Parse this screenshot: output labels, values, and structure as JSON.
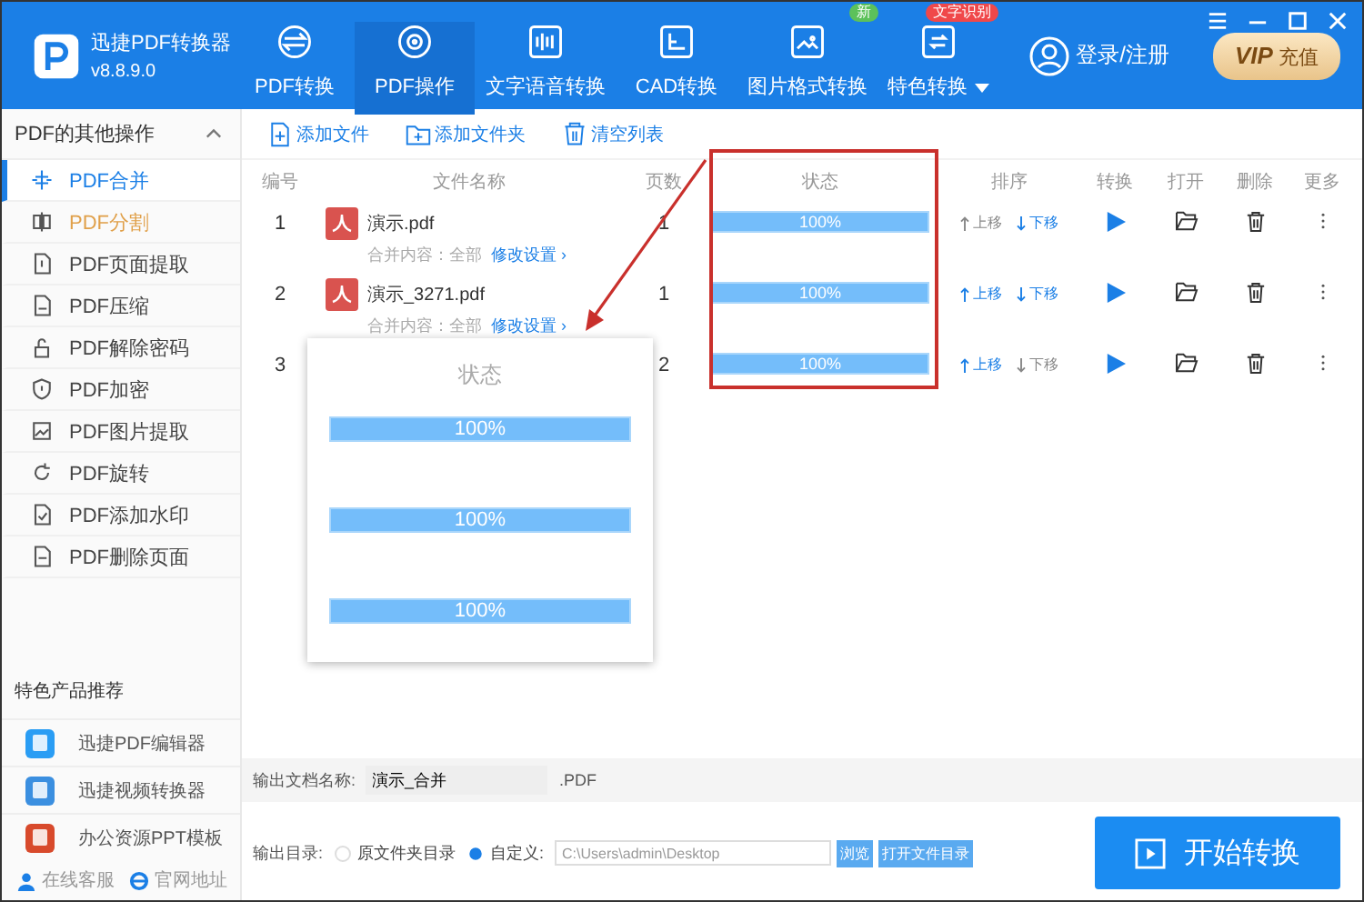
{
  "app": {
    "name": "迅捷PDF转换器",
    "version": "v8.8.9.0"
  },
  "nav": [
    {
      "label": "PDF转换",
      "selected": false
    },
    {
      "label": "PDF操作",
      "selected": true
    },
    {
      "label": "文字语音转换",
      "selected": false
    },
    {
      "label": "CAD转换",
      "selected": false
    },
    {
      "label": "图片格式转换",
      "selected": false,
      "badge": {
        "text": "新",
        "color": "#5cc15a"
      }
    },
    {
      "label": "特色转换",
      "selected": false,
      "badge": {
        "text": "文字识别",
        "color": "#f0484a"
      },
      "dropdown": true
    }
  ],
  "account": {
    "login": "登录/注册",
    "vip": "VIP",
    "vip_label": "充值"
  },
  "sidebar": {
    "title": "PDF的其他操作",
    "expanded": true,
    "items": [
      {
        "label": "PDF合并",
        "selected": true,
        "hovered": false
      },
      {
        "label": "PDF分割",
        "selected": false,
        "hovered": true
      },
      {
        "label": "PDF页面提取",
        "selected": false,
        "hovered": false
      },
      {
        "label": "PDF压缩",
        "selected": false,
        "hovered": false
      },
      {
        "label": "PDF解除密码",
        "selected": false,
        "hovered": false
      },
      {
        "label": "PDF加密",
        "selected": false,
        "hovered": false
      },
      {
        "label": "PDF图片提取",
        "selected": false,
        "hovered": false
      },
      {
        "label": "PDF旋转",
        "selected": false,
        "hovered": false
      },
      {
        "label": "PDF添加水印",
        "selected": false,
        "hovered": false
      },
      {
        "label": "PDF删除页面",
        "selected": false,
        "hovered": false
      }
    ],
    "products_title": "特色产品推荐",
    "products": [
      {
        "label": "迅捷PDF编辑器",
        "color": "#2a9df4"
      },
      {
        "label": "迅捷视频转换器",
        "color": "#3b8fe0"
      },
      {
        "label": "办公资源PPT模板",
        "color": "#d84a2c"
      }
    ],
    "links": [
      "在线客服",
      "官网地址"
    ]
  },
  "toolbar": [
    "添加文件",
    "添加文件夹",
    "清空列表"
  ],
  "table": {
    "columns": [
      "编号",
      "文件名称",
      "页数",
      "状态",
      "排序",
      "转换",
      "打开",
      "删除",
      "更多"
    ],
    "rows": [
      {
        "number": "1",
        "name": "演示.pdf",
        "merge_label": "合并内容：全部",
        "settings_link": "修改设置 ›",
        "pages": "1",
        "level": 1,
        "status": "100%",
        "up": "上移",
        "up_disabled": true,
        "down": "下移",
        "down_disabled": false
      },
      {
        "number": "2",
        "name": "演示_3271.pdf",
        "merge_label": "合并内容：全部",
        "settings_link": "修改设置 ›",
        "pages": "1",
        "level": 1,
        "status": "100%",
        "up": "上移",
        "up_disabled": false,
        "down": "下移",
        "down_disabled": false
      },
      {
        "number": "3",
        "pages": "2",
        "level": 1,
        "status": "100%",
        "up": "上移",
        "up_disabled": false,
        "down": "下移",
        "down_disabled": true
      }
    ]
  },
  "callout": {
    "title": "状态",
    "bars": [
      {
        "level": 1,
        "text": "100%"
      },
      {
        "level": 1,
        "text": "100%"
      },
      {
        "level": 1,
        "text": "100%"
      }
    ]
  },
  "output": {
    "name_label": "输出文档名称:",
    "name_value": "演示_合并",
    "ext": ".PDF",
    "dir_label": "输出目录:",
    "options": [
      {
        "label": "原文件夹目录",
        "selected": false
      },
      {
        "label": "自定义:",
        "selected": true
      }
    ],
    "path": "C:\\Users\\admin\\Desktop",
    "browse": "浏览",
    "open_dir": "打开文件目录"
  },
  "start_button": "开始转换"
}
